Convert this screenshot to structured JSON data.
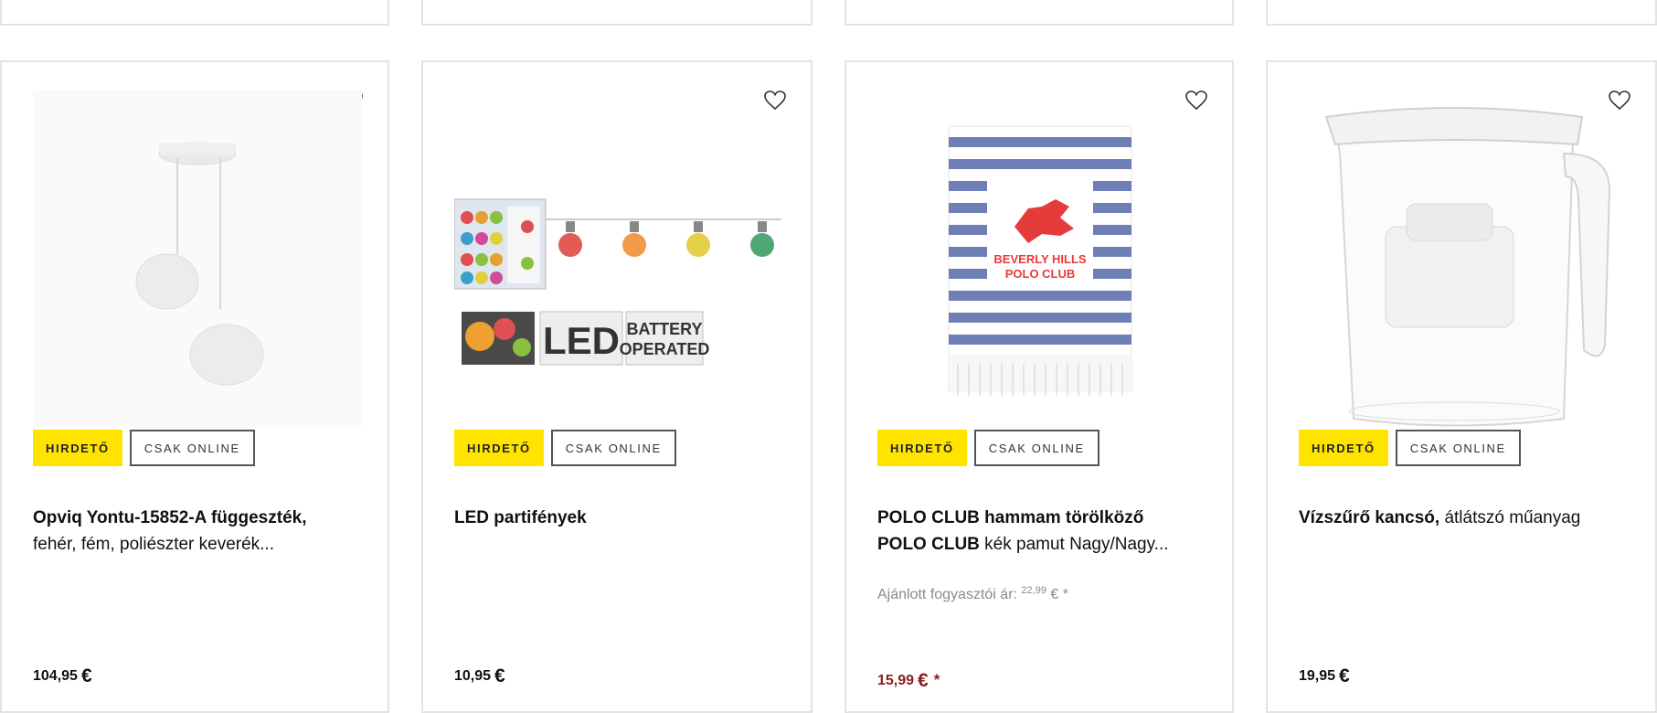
{
  "badges": {
    "hirdeto": "HIRDETŐ",
    "online": "CSAK ONLINE"
  },
  "products": [
    {
      "title_bold": "Opviq Yontu-15852-A függeszték,",
      "title_rest": "fehér, fém, poliészter keverék...",
      "price": "104,95",
      "currency": "€"
    },
    {
      "title_bold": "LED partifények",
      "title_rest": "",
      "price": "10,95",
      "currency": "€",
      "image_text": {
        "led": "LED",
        "battery_1": "BATTERY",
        "battery_2": "OPERATED"
      }
    },
    {
      "title_bold": "POLO CLUB hammam törölköző",
      "title_bold_2": "POLO CLUB",
      "title_rest": "kék pamut Nagy/Nagy...",
      "rrp_label": "Ajánlott fogyasztói ár:",
      "rrp_value": "22,99",
      "rrp_suffix": "€ *",
      "price": "15,99",
      "currency": "€",
      "price_star": "*",
      "image_text": {
        "line1": "BEVERLY HILLS",
        "line2": "POLO CLUB"
      }
    },
    {
      "title_bold": "Vízszűrő kancsó,",
      "title_rest": "átlátszó műanyag",
      "price": "19,95",
      "currency": "€"
    }
  ],
  "colors": {
    "badge_yellow": "#ffe400",
    "sale_red": "#8b1d1d",
    "border": "#e3e3e3"
  },
  "icons": [
    "heart-icon"
  ]
}
